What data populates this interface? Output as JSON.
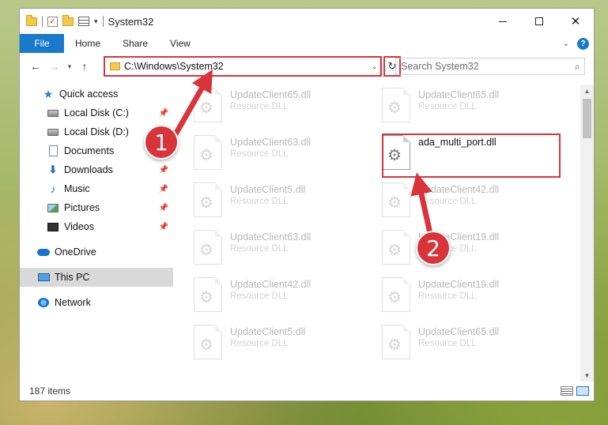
{
  "window": {
    "title": "System32",
    "controls": {
      "minimize": "—",
      "maximize": "☐",
      "close": "✕"
    }
  },
  "ribbon": {
    "tabs": [
      "File",
      "Home",
      "Share",
      "View"
    ],
    "help": "?"
  },
  "navbar": {
    "back": "←",
    "forward": "→",
    "recent": "▾",
    "up": "↑",
    "address": "C:\\Windows\\System32",
    "address_dropdown": "⌄",
    "refresh": "↻",
    "search_placeholder": "Search System32",
    "search_icon": "⌕"
  },
  "sidebar": {
    "items": [
      {
        "label": "Quick access",
        "icon": "star-icon",
        "pinned": false
      },
      {
        "label": "Local Disk (C:)",
        "icon": "drive-icon",
        "pinned": true
      },
      {
        "label": "Local Disk (D:)",
        "icon": "drive-icon",
        "pinned": false
      },
      {
        "label": "Documents",
        "icon": "documents-icon",
        "pinned": true
      },
      {
        "label": "Downloads",
        "icon": "download-icon",
        "pinned": true
      },
      {
        "label": "Music",
        "icon": "music-icon",
        "pinned": true
      },
      {
        "label": "Pictures",
        "icon": "pictures-icon",
        "pinned": true
      },
      {
        "label": "Videos",
        "icon": "videos-icon",
        "pinned": true
      },
      {
        "label": "OneDrive",
        "icon": "cloud-icon",
        "pinned": false
      },
      {
        "label": "This PC",
        "icon": "pc-icon",
        "pinned": false,
        "selected": true
      },
      {
        "label": "Network",
        "icon": "network-icon",
        "pinned": false
      }
    ]
  },
  "files": [
    {
      "name": "UpdateClient65.dll",
      "type": "Resource DLL",
      "faded": true
    },
    {
      "name": "UpdateClient65.dll",
      "type": "Resource DLL",
      "faded": true
    },
    {
      "name": "UpdateClient63.dll",
      "type": "Resource DLL",
      "faded": true
    },
    {
      "name": "ada_multi_port.dll",
      "type": "",
      "faded": false,
      "highlighted": true
    },
    {
      "name": "UpdateClient5.dll",
      "type": "Resource DLL",
      "faded": true
    },
    {
      "name": "UpdateClient42.dll",
      "type": "Resource DLL",
      "faded": true
    },
    {
      "name": "UpdateClient63.dll",
      "type": "Resource DLL",
      "faded": true
    },
    {
      "name": "UpdateClient19.dll",
      "type": "Resource DLL",
      "faded": true
    },
    {
      "name": "UpdateClient42.dll",
      "type": "Resource DLL",
      "faded": true
    },
    {
      "name": "UpdateClient19.dll",
      "type": "Resource DLL",
      "faded": true
    },
    {
      "name": "UpdateClient5.dll",
      "type": "Resource DLL",
      "faded": true
    },
    {
      "name": "UpdateClient65.dll",
      "type": "Resource DLL",
      "faded": true
    }
  ],
  "status": {
    "item_count": "187 items"
  },
  "annotations": {
    "step1": "1",
    "step2": "2",
    "color": "#d9343a"
  }
}
